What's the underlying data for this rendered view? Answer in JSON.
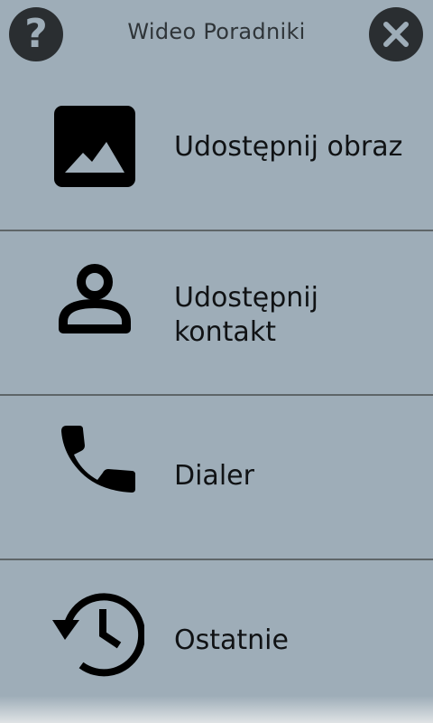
{
  "header": {
    "title": "Wideo Poradniki",
    "help_label": "?",
    "help_icon": "help-icon",
    "close_icon": "close-icon"
  },
  "menu": {
    "items": [
      {
        "label": "Udostępnij obraz",
        "icon": "image-icon"
      },
      {
        "label": "Udostępnij kontakt",
        "icon": "person-icon"
      },
      {
        "label": "Dialer",
        "icon": "phone-icon"
      },
      {
        "label": "Ostatnie",
        "icon": "history-icon"
      }
    ]
  },
  "colors": {
    "background": "#9eadb8",
    "button": "#2a2e31",
    "text": "#101214",
    "divider": "#5e6568"
  }
}
